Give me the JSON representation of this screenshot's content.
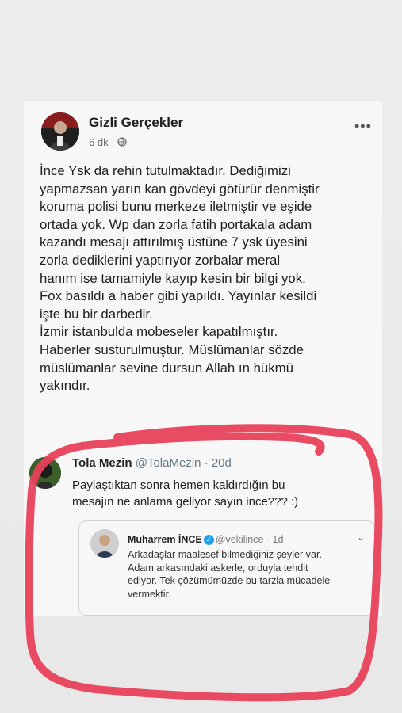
{
  "post": {
    "author": "Gizli Gerçekler",
    "time": "6 dk",
    "separator": " · ",
    "privacy_icon": "globe-icon",
    "more_icon": "more-dots-icon",
    "more_label": "•••",
    "text": "İnce Ysk da rehin tutulmaktadır. Dediğimizi\nyapmazsan yarın kan gövdeyi götürür denmiştir\nkoruma polisi bunu merkeze iletmiştir ve eşide\nortada yok. Wp dan zorla fatih portakala adam\nkazandı mesajı attırılmış üstüne 7 ysk üyesini\nzorla dediklerini yaptırıyor zorbalar meral\nhanım ise tamamiyle kayıp kesin bir bilgi yok.\nFox basıldı a haber gibi yapıldı. Yayınlar kesildi\nişte bu bir darbedir.\nİzmir istanbulda mobeseler kapatılmıştır.\nHaberler susturulmuştur. Müslümanlar sözde\nmüslümanlar sevine dursun Allah ın hükmü\nyakındır."
  },
  "tweet": {
    "name": "Tola Mezin",
    "handle": "@TolaMezin",
    "separator": " · ",
    "age": "20d",
    "text": "Paylaştıktan sonra hemen kaldırdığın bu\nmesajın ne anlama geliyor sayın ince??? :)"
  },
  "quoted": {
    "name": "Muharrem İNCE",
    "verified_icon": "verified-check-icon",
    "verified_glyph": "✓",
    "handle": "@vekilince",
    "separator": " · ",
    "age": "1d",
    "chevron_glyph": "⌄",
    "text": "Arkadaşlar maalesef bilmediğiniz şeyler var.\nAdam arkasındaki askerle, orduyla tehdit\nediyor. Tek çözümümüzde bu tarzla mücadele\nvermektir."
  },
  "colors": {
    "annotation": "#e8415a",
    "verified": "#1da1f2"
  }
}
